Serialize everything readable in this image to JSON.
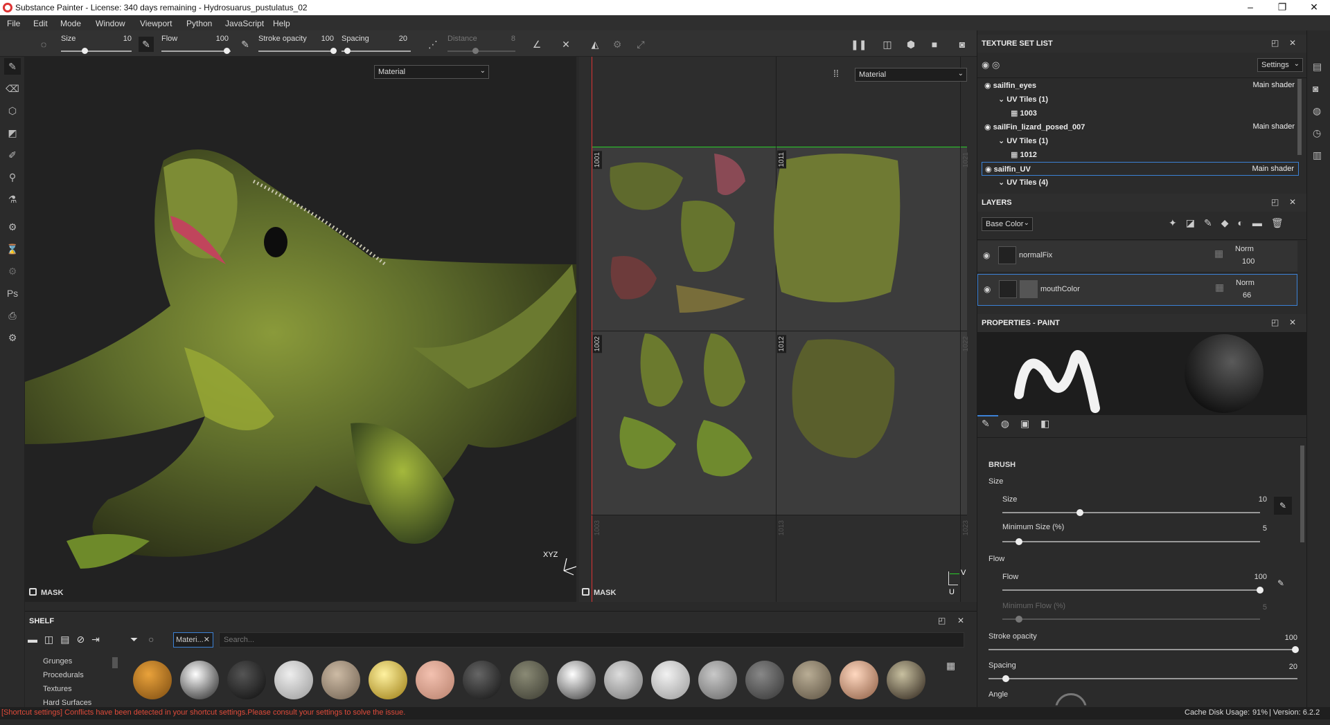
{
  "window": {
    "title": "Substance Painter - License: 340 days remaining - Hydrosuarus_pustulatus_02"
  },
  "menu": [
    "File",
    "Edit",
    "Mode",
    "Window",
    "Viewport",
    "Python",
    "JavaScript",
    "Help"
  ],
  "toolbar": {
    "size_label": "Size",
    "size_value": "10",
    "flow_label": "Flow",
    "flow_value": "100",
    "stroke_label": "Stroke opacity",
    "stroke_value": "100",
    "spacing_label": "Spacing",
    "spacing_value": "20",
    "distance_label": "Distance",
    "distance_value": "8"
  },
  "viewport3d": {
    "mode": "Material",
    "mask_label": "MASK",
    "axes": "XYZ"
  },
  "viewport2d": {
    "mode": "Material",
    "mask_label": "MASK",
    "tiles": [
      "1001",
      "1011",
      "1021",
      "1002",
      "1012",
      "1022",
      "1003",
      "1013",
      "1023"
    ],
    "uv_v": "V",
    "uv_u": "U"
  },
  "texture_set_list": {
    "title": "TEXTURE SET LIST",
    "settings_label": "Settings",
    "rows": [
      {
        "name": "sailfin_eyes",
        "shader": "Main shader"
      },
      {
        "name": "UV Tiles (1)"
      },
      {
        "name": "1003"
      },
      {
        "name": "sailFin_lizard_posed_007",
        "shader": "Main shader"
      },
      {
        "name": "UV Tiles (1)"
      },
      {
        "name": "1012"
      },
      {
        "name": "sailfin_UV",
        "shader": "Main shader"
      },
      {
        "name": "UV Tiles (4)"
      }
    ]
  },
  "layers": {
    "title": "LAYERS",
    "channel": "Base Color",
    "items": [
      {
        "name": "normalFix",
        "blend": "Norm",
        "opacity": "100"
      },
      {
        "name": "mouthColor",
        "blend": "Norm",
        "opacity": "66"
      }
    ]
  },
  "properties": {
    "title": "PROPERTIES - PAINT",
    "brush_heading": "BRUSH",
    "size_group": "Size",
    "size_label": "Size",
    "size_value": "10",
    "size_frac": 0.3,
    "min_size_label": "Minimum Size (%)",
    "min_size_value": "5",
    "min_size_frac": 0.05,
    "flow_group": "Flow",
    "flow_label": "Flow",
    "flow_value": "100",
    "flow_frac": 1.0,
    "min_flow_label": "Minimum Flow (%)",
    "min_flow_value": "5",
    "stroke_label": "Stroke opacity",
    "stroke_value": "100",
    "spacing_label": "Spacing",
    "spacing_value": "20",
    "angle_label": "Angle"
  },
  "shelf": {
    "title": "SHELF",
    "filter_chip": "Materi...",
    "search_placeholder": "Search...",
    "categories": [
      "Grunges",
      "Procedurals",
      "Textures",
      "Hard Surfaces"
    ]
  },
  "status": {
    "warning": "[Shortcut settings] Conflicts have been detected in your shortcut settings.Please consult your settings to solve the issue.",
    "cache": "Cache Disk Usage:",
    "cache_value": "91%",
    "version": "| Version: 6.2.2"
  },
  "colors": {
    "accent": "#3c82d7",
    "warning": "#e04b3a"
  }
}
